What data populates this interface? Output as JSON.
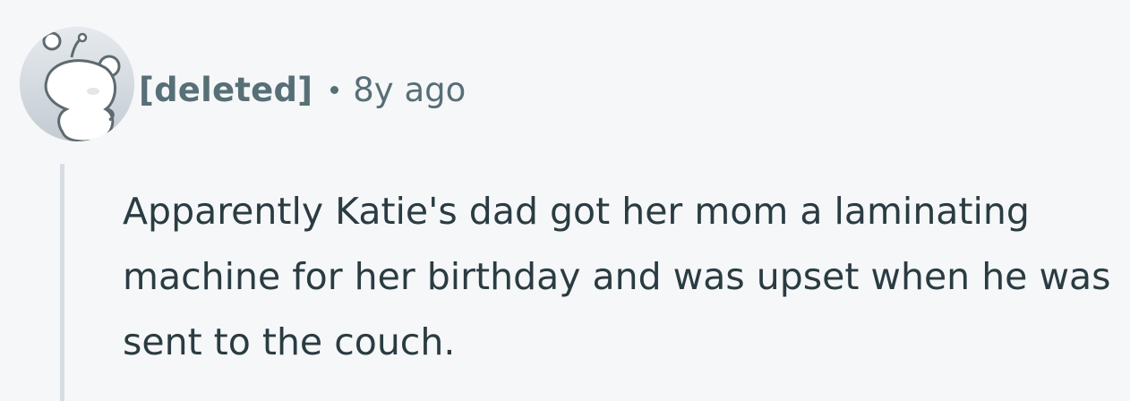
{
  "comment": {
    "author": "[deleted]",
    "separator": "•",
    "time_ago": "8y ago",
    "body": "Apparently Katie's dad got her mom a laminating machine for her birthday and was upset when he was sent to the couch.",
    "avatar_icon": "snoo-avatar-icon"
  },
  "colors": {
    "background": "#f6f7f9",
    "meta_text": "#576f76",
    "body_text": "#2a3c42",
    "thread_line": "#d7dde3"
  }
}
